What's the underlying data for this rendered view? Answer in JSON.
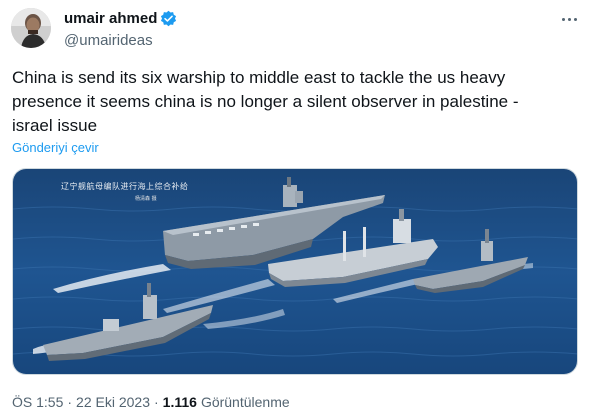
{
  "author": {
    "display_name": "umair ahmed",
    "handle": "@umairideas",
    "verified": true,
    "verified_color": "#1d9bf0"
  },
  "tweet": {
    "text": "China is send its six warship to middle east to tackle the us heavy\npresence it seems china is no longer a silent observer in palestine -\nisrael issue",
    "translate_label": "Gönderiyi çevir",
    "media_caption": "辽宁舰航母编队进行海上综合补给",
    "media_caption_credit": "杨清森 摄",
    "time": "ÖS 1:55",
    "date": "22 Eki 2023",
    "views_count": "1.116",
    "views_label": "Görüntülenme"
  },
  "icons": {
    "more": "more-dots-icon",
    "verified": "verified-badge-icon"
  },
  "colors": {
    "link": "#1d9bf0",
    "secondary_text": "#536471",
    "sea": "#1f4f87"
  }
}
